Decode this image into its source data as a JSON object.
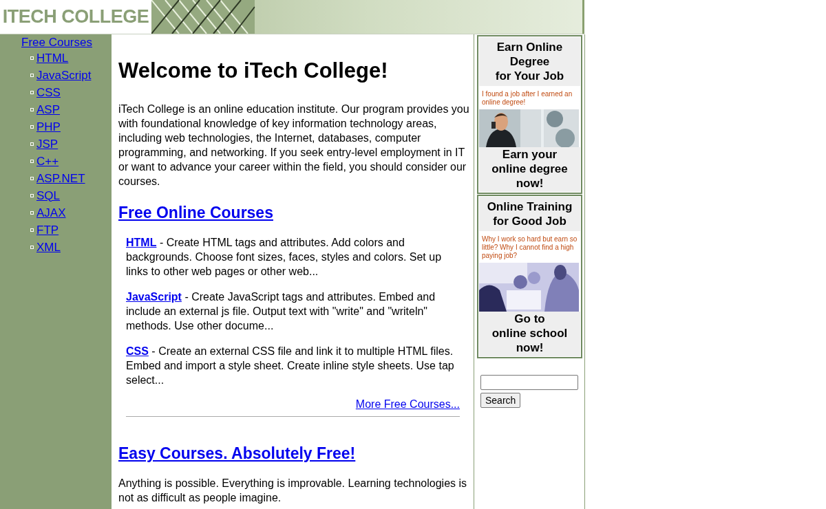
{
  "header": {
    "logo": "ITECH COLLEGE"
  },
  "sidebar": {
    "heading": "Free Courses",
    "items": [
      "HTML",
      "JavaScript",
      "CSS",
      "ASP",
      "PHP",
      "JSP",
      "C++",
      "ASP.NET",
      "SQL",
      "AJAX",
      "FTP",
      "XML"
    ]
  },
  "main": {
    "title": "Welcome to iTech College!",
    "intro": "iTech College is an online education institute. Our program provides you with foundational knowledge of key information technology areas, including web technologies, the Internet, databases, computer programming, and networking. If you seek entry-level employment in IT or want to advance your career within the field, you should consider our courses.",
    "sections": [
      {
        "heading": "Free Online Courses",
        "courses": [
          {
            "name": "HTML",
            "description": " - Create HTML tags and attributes. Add colors and backgrounds. Choose font sizes, faces, styles and colors. Set up links to other web pages or other web..."
          },
          {
            "name": "JavaScript",
            "description": " - Create JavaScript tags and attributes. Embed and include an external js file. Output text with \"write\" and \"writeln\" methods. Use other docume..."
          },
          {
            "name": "CSS",
            "description": " - Create an external CSS file and link it to multiple HTML files. Embed and import a style sheet. Create inline style sheets. Use tap select..."
          }
        ],
        "more_link": "More Free Courses..."
      },
      {
        "heading": "Easy Courses. Absolutely Free!",
        "text": "Anything is possible. Everything is improvable. Learning technologies is not as difficult as people imagine."
      }
    ]
  },
  "ads": [
    {
      "title": "Earn Online\nDegree\nfor Your Job",
      "caption": "I found a job after I earned an online degree!",
      "cta": "Earn your\nonline degree\nnow!",
      "kind": "picture"
    },
    {
      "title": "Online Training\nfor Good Job",
      "caption": "Why I work so hard but earn so little? Why I cannot find a high paying job?",
      "cta": "Go to\nonline school\nnow!",
      "kind": "picture"
    }
  ],
  "search": {
    "button": "Search"
  }
}
